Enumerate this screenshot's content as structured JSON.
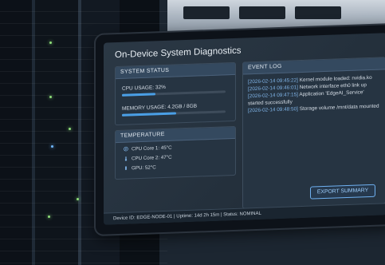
{
  "window": {
    "title": "On-Device System Diagnostics"
  },
  "status": {
    "header": "SYSTEM STATUS",
    "cpu_label": "CPU USAGE: 32%",
    "cpu_fraction": 0.32,
    "mem_label": "MEMORY USAGE: 4.2GB / 8GB",
    "mem_fraction": 0.525
  },
  "temperature": {
    "header": "TEMPERATURE",
    "rows": [
      {
        "label": "CPU Core 1: 45°C",
        "icon": "chip-icon"
      },
      {
        "label": "CPU Core 2: 47°C",
        "icon": "thermometer-icon"
      },
      {
        "label": "GPU: 52°C",
        "icon": "gpu-icon"
      }
    ]
  },
  "event_log": {
    "header": "EVENT LOG",
    "entries": [
      {
        "ts": "[2026-02-14 09:45:22]",
        "msg": "Kernel module loaded: nvidia.ko"
      },
      {
        "ts": "[2026-02-14 09:46:01]",
        "msg": "Network interface eth0 link up"
      },
      {
        "ts": "[2026-02-14 09:47:15]",
        "msg": "Application 'EdgeAI_Service' started successfully"
      },
      {
        "ts": "[2026-02-14 09:48:50]",
        "msg": "Storage volume /mnt/data mounted"
      }
    ]
  },
  "actions": {
    "export_label": "EXPORT SUMMARY"
  },
  "footer": {
    "text": "Device ID: EDGE-NODE-01 | Uptime: 14d 2h 15m | Status: NOMINAL"
  },
  "colors": {
    "accent": "#4a9fe6",
    "panel": "#263442",
    "header": "#34495f"
  }
}
